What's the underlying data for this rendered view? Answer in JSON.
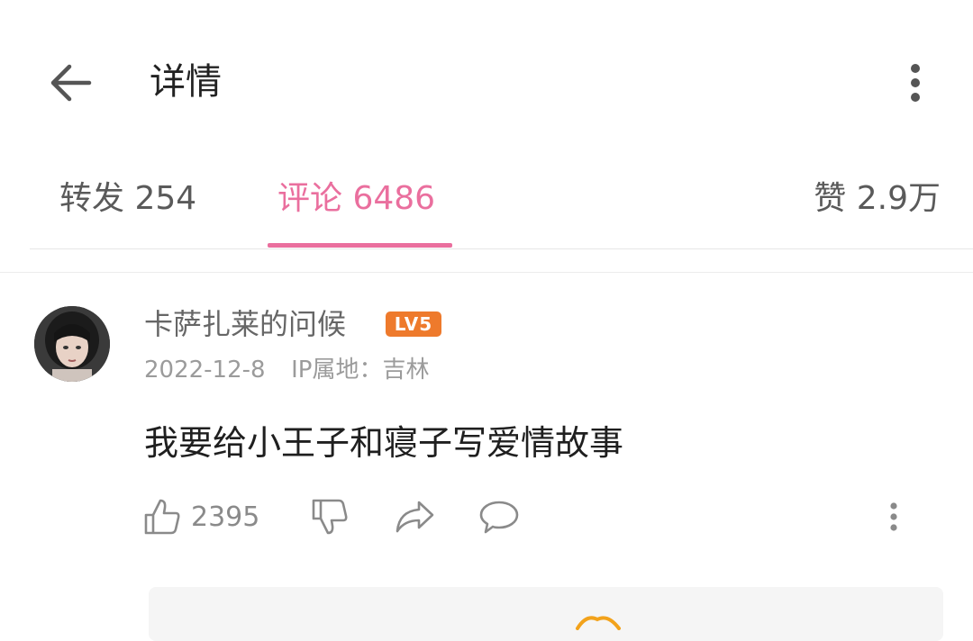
{
  "header": {
    "title": "详情",
    "back_icon": "arrow-left-icon",
    "more_icon": "more-vertical-icon"
  },
  "tabs": {
    "repost": "转发 254",
    "comment": "评论 6486",
    "like": "赞 2.9万",
    "active": "comment",
    "accent_color": "#ea6f9e"
  },
  "comment": {
    "username": "卡萨扎莱的问候",
    "level": "LV5",
    "level_color": "#ee7a2c",
    "date": "2022-12-8",
    "ip_location": "IP属地：吉林",
    "text": "我要给小王子和寝子写爱情故事",
    "like_count": "2395",
    "icons": [
      "thumbs-up-icon",
      "thumbs-down-icon",
      "share-icon",
      "comment-bubble-icon",
      "more-vertical-icon"
    ]
  }
}
